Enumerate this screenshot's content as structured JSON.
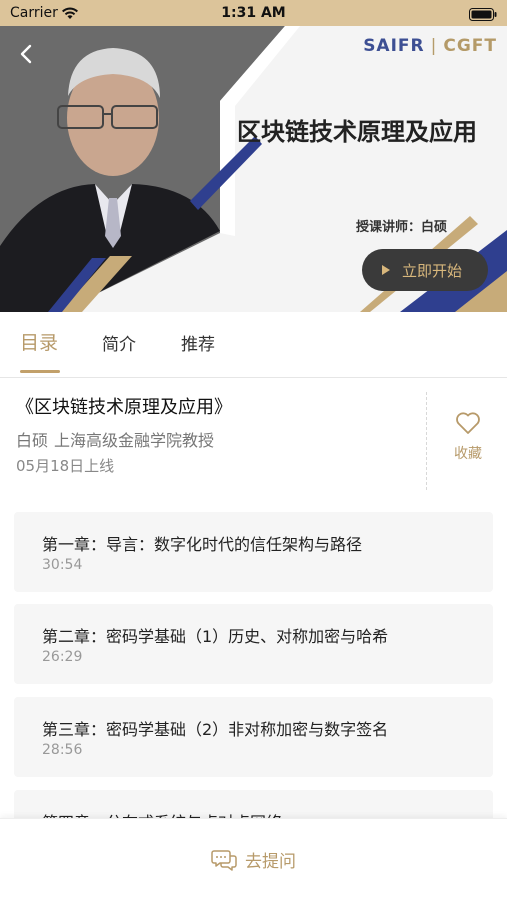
{
  "status_bar": {
    "carrier": "Carrier",
    "time": "1:31 AM",
    "wifi_icon": "wifi-icon",
    "battery_icon": "battery-icon"
  },
  "hero": {
    "logo_left": "SAIFR",
    "logo_right": "CGFT",
    "title": "区块链技术原理及应用",
    "lecturer": "授课讲师：白硕",
    "start_label": "立即开始",
    "back_icon": "back-arrow-icon",
    "colors": {
      "navy": "#2f3f8f",
      "gold": "#c7ab79",
      "dark": "#3a3a3a",
      "photo_bg": "#6a6a6a"
    }
  },
  "tabs": [
    {
      "label": "目录",
      "active": true
    },
    {
      "label": "简介",
      "active": false
    },
    {
      "label": "推荐",
      "active": false
    }
  ],
  "course": {
    "title": "《区块链技术原理及应用》",
    "teacher_name": "白硕",
    "teacher_title": "上海高级金融学院教授",
    "date": "05月18日上线",
    "favorite_label": "收藏"
  },
  "chapters": [
    {
      "title": "第一章：导言：数字化时代的信任架构与路径",
      "duration": "30:54"
    },
    {
      "title": "第二章：密码学基础（1）历史、对称加密与哈希",
      "duration": "26:29"
    },
    {
      "title": "第三章：密码学基础（2）非对称加密与数字签名",
      "duration": "28:56"
    },
    {
      "title": "第四章：分布式系统与点对点网络",
      "duration": ""
    }
  ],
  "bottom": {
    "ask_label": "去提问",
    "ask_icon": "chat-bubble-icon"
  },
  "colors": {
    "accent_gold": "#b79a6a",
    "status_bar": "#dcc49a",
    "card_bg": "#f6f6f6"
  }
}
